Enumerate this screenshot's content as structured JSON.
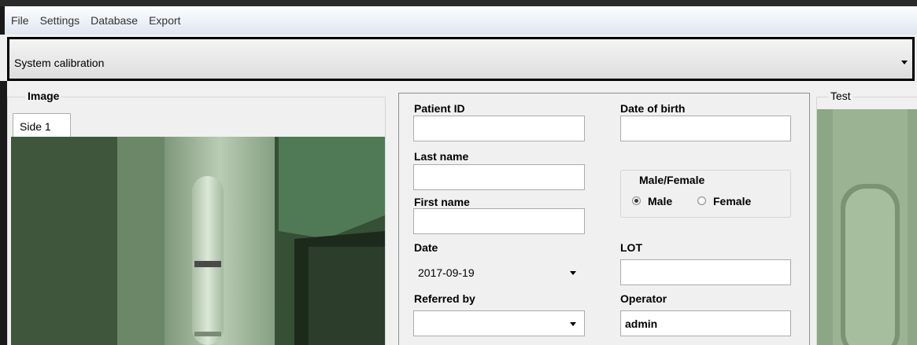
{
  "menu": [
    "File",
    "Settings",
    "Database",
    "Export"
  ],
  "mode_select": {
    "value": "System calibration"
  },
  "image_panel": {
    "title": "Image",
    "tabs": [
      "Side 1"
    ]
  },
  "patient_form": {
    "patient_id": {
      "label": "Patient ID",
      "value": ""
    },
    "date_of_birth": {
      "label": "Date of birth",
      "value": ""
    },
    "last_name": {
      "label": "Last name",
      "value": ""
    },
    "first_name": {
      "label": "First name",
      "value": ""
    },
    "gender": {
      "title": "Male/Female",
      "options": [
        "Male",
        "Female"
      ],
      "selected": "Male"
    },
    "date": {
      "label": "Date",
      "value": "2017-09-19"
    },
    "lot": {
      "label": "LOT",
      "value": ""
    },
    "referred_by": {
      "label": "Referred by",
      "value": ""
    },
    "operator": {
      "label": "Operator",
      "value": "admin"
    }
  },
  "test_panel": {
    "title": "Test"
  }
}
